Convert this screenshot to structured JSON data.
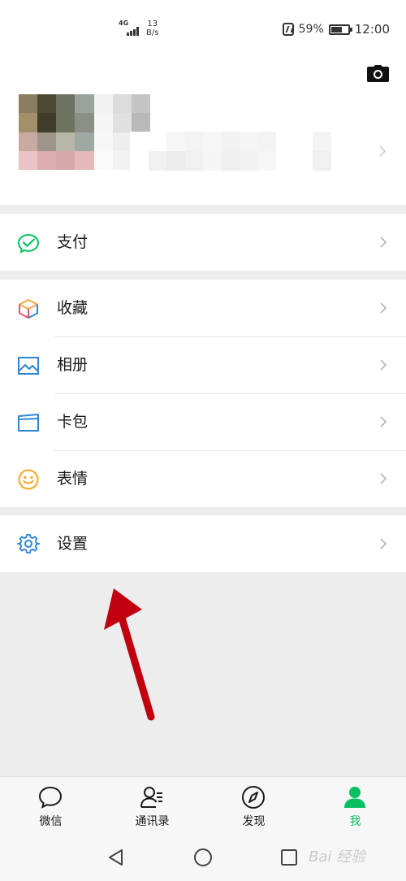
{
  "status_bar": {
    "network_type": "4G",
    "speed_value": "13",
    "speed_unit": "B/s",
    "battery_percent": "59%",
    "battery_level": 0.59,
    "time": "12:00"
  },
  "profile": {
    "camera_icon": "camera-icon",
    "chevron_icon": "chevron-right-icon"
  },
  "groups": [
    {
      "items": [
        {
          "label": "支付",
          "icon": "wallet-check-icon",
          "color": "#07c160"
        }
      ]
    },
    {
      "items": [
        {
          "label": "收藏",
          "icon": "cube-icon",
          "color": "#f4a742"
        },
        {
          "label": "相册",
          "icon": "picture-icon",
          "color": "#2f86d6"
        },
        {
          "label": "卡包",
          "icon": "card-icon",
          "color": "#2f86d6"
        },
        {
          "label": "表情",
          "icon": "smiley-icon",
          "color": "#f5a623"
        }
      ]
    },
    {
      "items": [
        {
          "label": "设置",
          "icon": "gear-icon",
          "color": "#2f86d6"
        }
      ]
    }
  ],
  "tab_bar": {
    "tabs": [
      {
        "label": "微信",
        "icon": "chat-bubble-icon",
        "active": false
      },
      {
        "label": "通讯录",
        "icon": "contacts-icon",
        "active": false
      },
      {
        "label": "发现",
        "icon": "compass-icon",
        "active": false
      },
      {
        "label": "我",
        "icon": "person-icon",
        "active": true
      }
    ],
    "active_color": "#07c160"
  },
  "system_nav": {
    "watermark": "Bai 经验"
  },
  "colors": {
    "accent": "#07c160",
    "background": "#ededed",
    "arrow": "#c0000f"
  }
}
